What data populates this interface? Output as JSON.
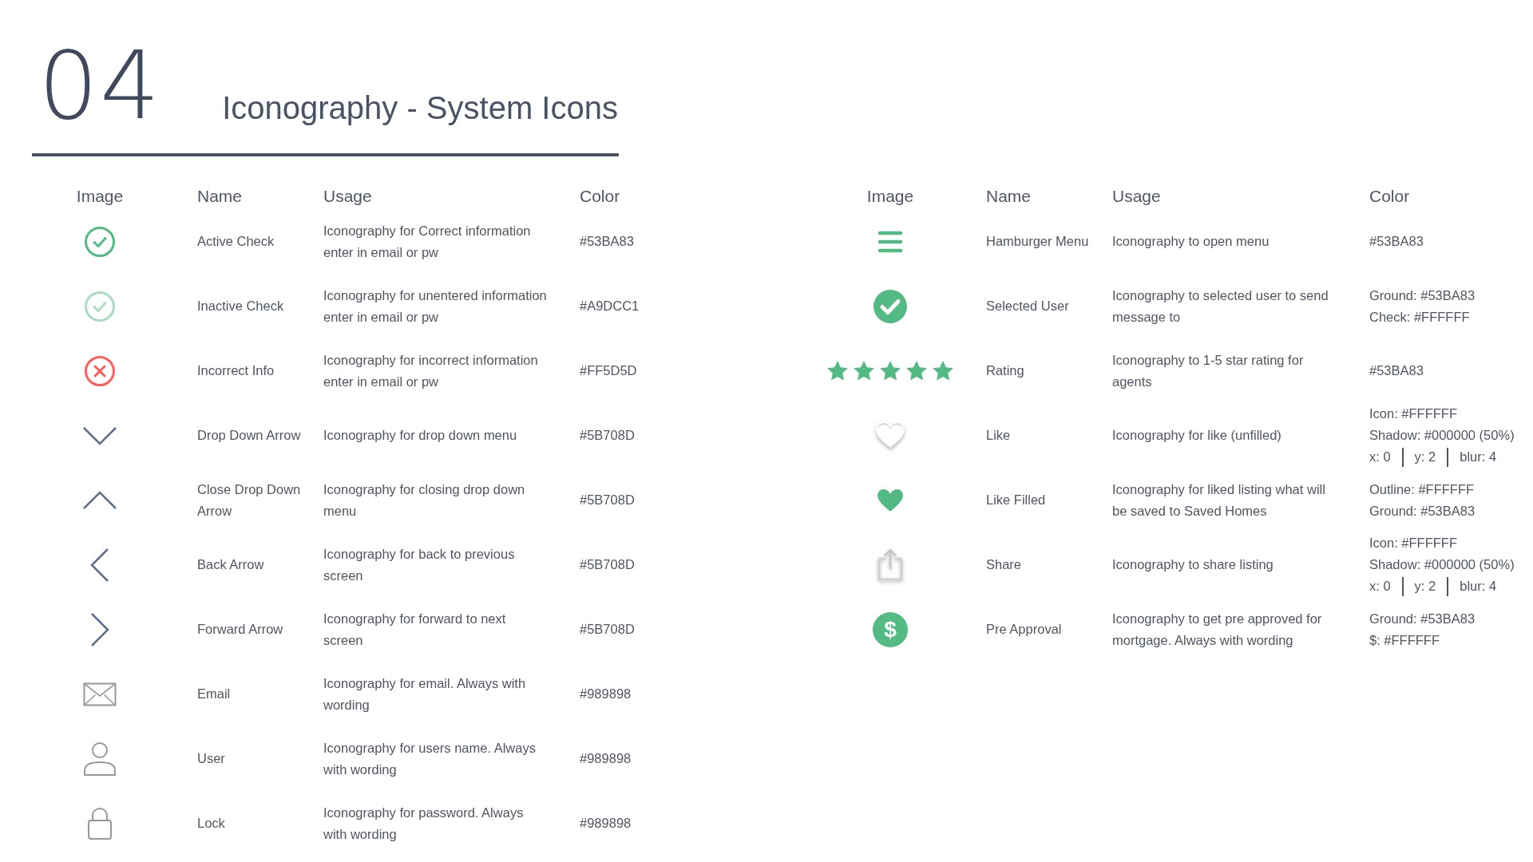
{
  "header": {
    "number": "04",
    "title": "Iconography - System Icons"
  },
  "tables": [
    {
      "columns": [
        "Image",
        "Name",
        "Usage",
        "Color"
      ],
      "rows": [
        {
          "kind": "checkoutline",
          "name": "Active Check",
          "usage": "Iconography for Correct information enter in email or pw",
          "color_lines": [
            [
              "#53BA83"
            ]
          ]
        },
        {
          "kind": "checkfaint",
          "name": "Inactive Check",
          "usage": "Iconography for unentered information enter in email or pw",
          "color_lines": [
            [
              "#A9DCC1"
            ]
          ]
        },
        {
          "kind": "error",
          "name": "Incorrect Info",
          "usage": "Iconography for incorrect information enter in email or pw",
          "color_lines": [
            [
              "#FF5D5D"
            ]
          ]
        },
        {
          "kind": "down",
          "name": "Drop Down Arrow",
          "usage": "Iconography for drop down menu",
          "color_lines": [
            [
              "#5B708D"
            ]
          ]
        },
        {
          "kind": "up",
          "name": "Close Drop Down Arrow",
          "usage": "Iconography for closing drop down menu",
          "color_lines": [
            [
              "#5B708D"
            ]
          ]
        },
        {
          "kind": "back",
          "name": "Back Arrow",
          "usage": "Iconography for back to previous screen",
          "color_lines": [
            [
              "#5B708D"
            ]
          ]
        },
        {
          "kind": "forward",
          "name": "Forward Arrow",
          "usage": "Iconography for forward to next screen",
          "color_lines": [
            [
              "#5B708D"
            ]
          ]
        },
        {
          "kind": "envelope",
          "name": "Email",
          "usage": "Iconography for email. Always with wording",
          "color_lines": [
            [
              "#989898"
            ]
          ]
        },
        {
          "kind": "user",
          "name": "User",
          "usage": "Iconography for users name. Always with wording",
          "color_lines": [
            [
              "#989898"
            ]
          ]
        },
        {
          "kind": "lock",
          "name": "Lock",
          "usage": "Iconography for password. Always with wording",
          "color_lines": [
            [
              "#989898"
            ]
          ]
        }
      ]
    },
    {
      "columns": [
        "Image",
        "Name",
        "Usage",
        "Color"
      ],
      "rows": [
        {
          "kind": "menu",
          "name": "Hamburger Menu",
          "usage": "Iconography to open menu",
          "color_lines": [
            [
              "#53BA83"
            ]
          ]
        },
        {
          "kind": "checkfilled",
          "name": "Selected User",
          "usage": "Iconography to selected user to send message to",
          "color_lines": [
            [
              "Ground: #53BA83"
            ],
            [
              "Check: #FFFFFF"
            ]
          ]
        },
        {
          "kind": "stars",
          "stars": 5,
          "name": "Rating",
          "usage": "Iconography to 1-5 star rating for agents",
          "color_lines": [
            [
              "#53BA83"
            ]
          ]
        },
        {
          "kind": "heartoutline",
          "name": "Like",
          "usage": "Iconography for like (unfilled)",
          "color_lines": [
            [
              "Icon: #FFFFFF"
            ],
            [
              "Shadow: #000000 (50%)"
            ],
            [
              "x: 0",
              "y: 2",
              "blur: 4"
            ]
          ]
        },
        {
          "kind": "heartfilled",
          "name": "Like Filled",
          "usage": "Iconography for liked listing what will be saved to Saved Homes",
          "color_lines": [
            [
              "Outline: #FFFFFF"
            ],
            [
              "Ground: #53BA83"
            ]
          ]
        },
        {
          "kind": "share",
          "name": "Share",
          "usage": "Iconography to share listing",
          "color_lines": [
            [
              "Icon: #FFFFFF"
            ],
            [
              "Shadow: #000000 (50%)"
            ],
            [
              "x: 0",
              "y: 2",
              "blur: 4"
            ]
          ]
        },
        {
          "kind": "dollar",
          "symbol": "$",
          "name": "Pre Approval",
          "usage": "Iconography to get pre approved for mortgage. Always with wording",
          "color_lines": [
            [
              "Ground: #53BA83"
            ],
            [
              "$: #FFFFFF"
            ]
          ]
        }
      ]
    }
  ]
}
